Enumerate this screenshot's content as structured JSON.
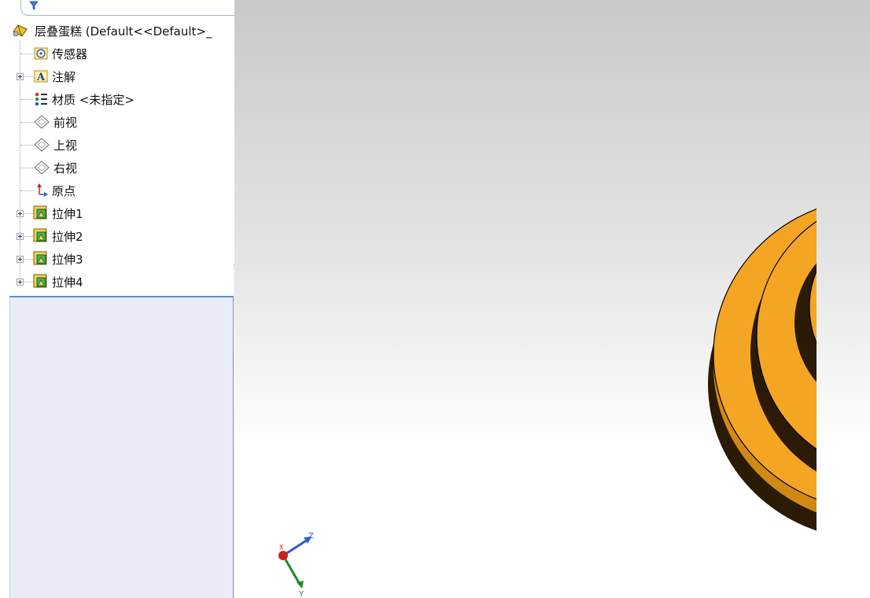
{
  "tree": {
    "root_label": "层叠蛋糕  (Default<<Default>_",
    "items": [
      {
        "label": "传感器",
        "icon": "sensor-icon",
        "expandable": false
      },
      {
        "label": "注解",
        "icon": "annotation-icon",
        "expandable": true
      },
      {
        "label": "材质 <未指定>",
        "icon": "material-icon",
        "expandable": false
      },
      {
        "label": "前视",
        "icon": "plane-icon",
        "expandable": false
      },
      {
        "label": "上视",
        "icon": "plane-icon",
        "expandable": false
      },
      {
        "label": "右视",
        "icon": "plane-icon",
        "expandable": false
      },
      {
        "label": "原点",
        "icon": "origin-icon",
        "expandable": false
      },
      {
        "label": "拉伸1",
        "icon": "extrude-icon",
        "expandable": true
      },
      {
        "label": "拉伸2",
        "icon": "extrude-icon",
        "expandable": true
      },
      {
        "label": "拉伸3",
        "icon": "extrude-icon",
        "expandable": true
      },
      {
        "label": "拉伸4",
        "icon": "extrude-icon",
        "expandable": true
      }
    ]
  },
  "triad": {
    "x_label": "X",
    "y_label": "Y",
    "z_label": "Z"
  },
  "colors": {
    "model_face": "#f5a524",
    "model_shadow": "#2b1a04",
    "accent": "#2e63b8"
  }
}
